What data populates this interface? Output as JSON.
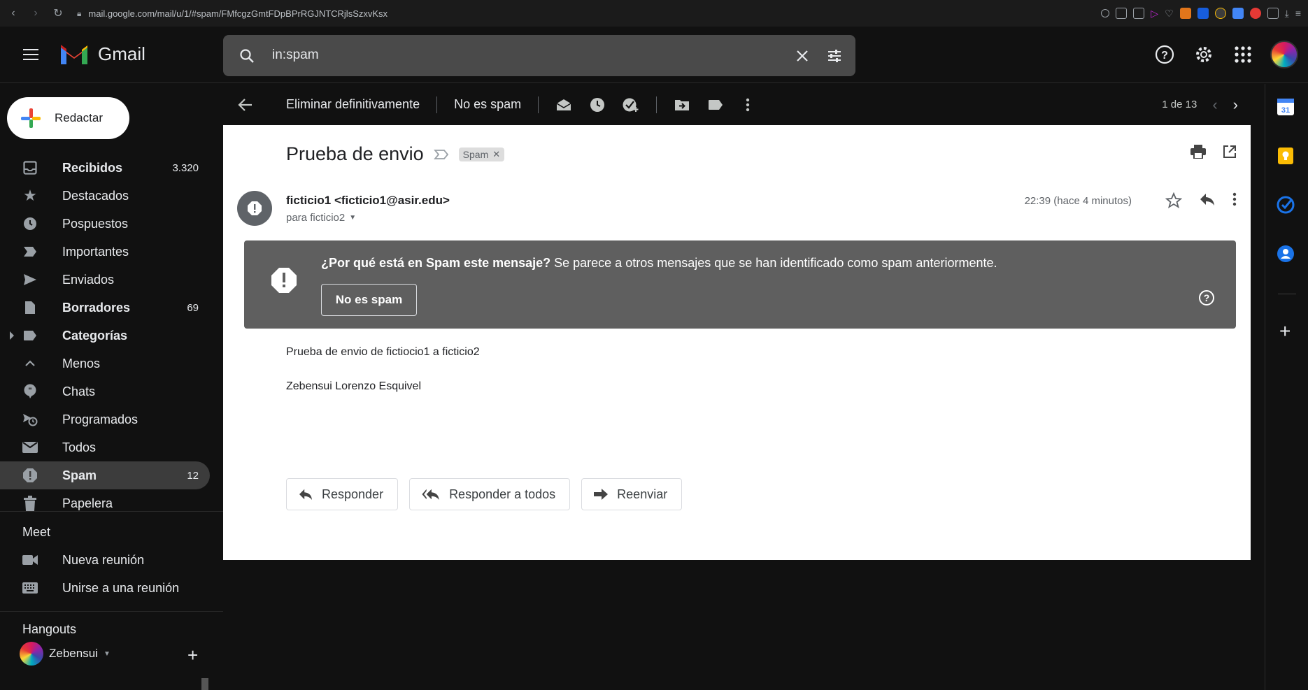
{
  "browser": {
    "url": "mail.google.com/mail/u/1/#spam/FMfcgzGmtFDpBPrRGJNTCRjlsSzxvKsx"
  },
  "header": {
    "app_name": "Gmail",
    "search_value": "in:spam"
  },
  "compose": {
    "label": "Redactar"
  },
  "nav": {
    "items": [
      {
        "label": "Recibidos",
        "count": "3.320"
      },
      {
        "label": "Destacados",
        "count": ""
      },
      {
        "label": "Pospuestos",
        "count": ""
      },
      {
        "label": "Importantes",
        "count": ""
      },
      {
        "label": "Enviados",
        "count": ""
      },
      {
        "label": "Borradores",
        "count": "69"
      },
      {
        "label": "Categorías",
        "count": ""
      },
      {
        "label": "Menos",
        "count": ""
      },
      {
        "label": "Chats",
        "count": ""
      },
      {
        "label": "Programados",
        "count": ""
      },
      {
        "label": "Todos",
        "count": ""
      },
      {
        "label": "Spam",
        "count": "12"
      },
      {
        "label": "Papelera",
        "count": ""
      }
    ]
  },
  "meet": {
    "title": "Meet",
    "new_meeting": "Nueva reunión",
    "join_meeting": "Unirse a una reunión"
  },
  "hangouts": {
    "title": "Hangouts",
    "user": "Zebensui"
  },
  "toolbar": {
    "delete_forever": "Eliminar definitivamente",
    "not_spam": "No es spam",
    "pager": "1 de 13"
  },
  "email": {
    "subject": "Prueba de envio",
    "label": "Spam",
    "sender": "ficticio1 <ficticio1@asir.edu>",
    "to": "para ficticio2",
    "time": "22:39 (hace 4 minutos)",
    "spam_title": "¿Por qué está en Spam este mensaje?",
    "spam_reason": " Se parece a otros mensajes que se han identificado como spam anteriormente.",
    "spam_button": "No es spam",
    "body_line1": "Prueba de envio de fictiocio1 a ficticio2",
    "body_line2": "Zebensui Lorenzo Esquivel",
    "reply": "Responder",
    "reply_all": "Responder a todos",
    "forward": "Reenviar"
  },
  "colors": {
    "background": "#111111",
    "spam_banner": "#5f5f5f",
    "active_nav": "#3c3c3c"
  }
}
